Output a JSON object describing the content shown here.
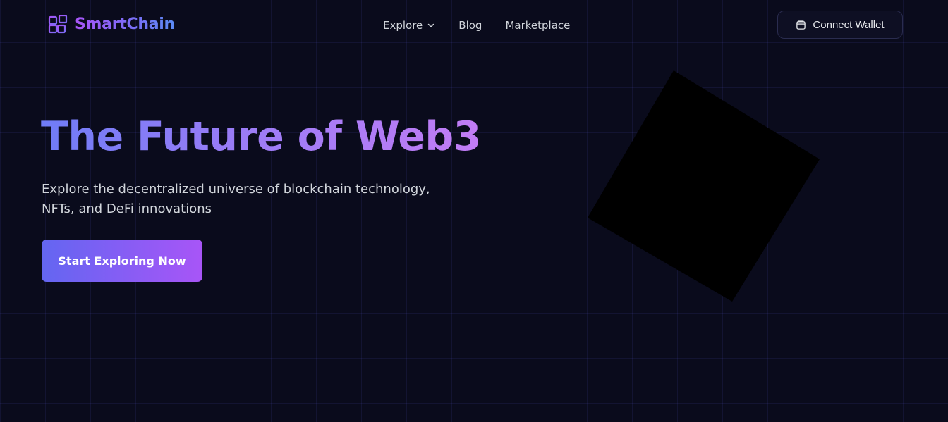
{
  "header": {
    "brand": {
      "name": "SmartChain",
      "icon": "blocks-icon"
    },
    "nav": [
      {
        "label": "Explore",
        "has_dropdown": true,
        "icon": "chevron-down-icon"
      },
      {
        "label": "Blog"
      },
      {
        "label": "Marketplace"
      }
    ],
    "connect_wallet": {
      "label": "Connect Wallet",
      "icon": "wallet-icon"
    }
  },
  "hero": {
    "title": "The Future of Web3",
    "subtitle": "Explore the decentralized universe of blockchain technology, NFTs, and DeFi innovations",
    "cta_label": "Start Exploring Now"
  },
  "colors": {
    "background": "#0a0b1c",
    "grid_line": "#1c1d3f",
    "accent_indigo": "#6366f1",
    "accent_purple": "#a855f7",
    "cube_fill": "#000000"
  }
}
